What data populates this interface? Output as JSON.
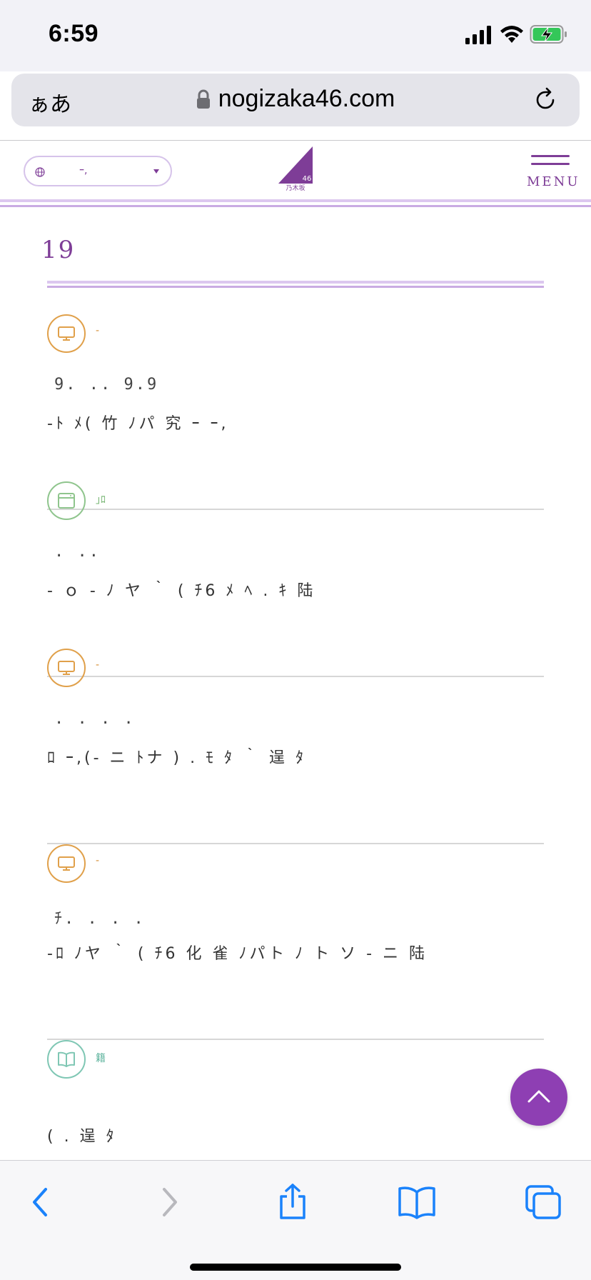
{
  "status_bar": {
    "time": "6:59"
  },
  "browser": {
    "text_size_label": "ぁあ",
    "url": "nogizaka46.com"
  },
  "header": {
    "language_value": "ｰ,",
    "logo_text": "46",
    "logo_subtext": "乃木坂",
    "menu_label": "MENU"
  },
  "page": {
    "heading": "19"
  },
  "news": [
    {
      "icon": "tv-icon",
      "category": "-",
      "date": "9. .. 9.9",
      "title": "‐ﾄ ﾒ( 竹 ﾉパ 究 ｰ ｰ,"
    },
    {
      "icon": "web-icon",
      "category": "｣ﾛ",
      "date": ". ..",
      "title": "‐ ｏ ‐ ﾉ ヤ ｀ ( ﾁ6  ﾒ ﾍ . ｷ 陆"
    },
    {
      "icon": "tv-icon",
      "category": "-",
      "date": ". . . .",
      "title": "ﾛ ｰ,(‐ ニ ﾄナ ) . ﾓ ﾀ ｀ 逞 ﾀ"
    },
    {
      "icon": "tv-icon",
      "category": "-",
      "date": "ﾁ. . . .",
      "title": "‐ﾛ ﾉヤ ｀ ( ﾁ6 化 雀 ﾉパト ﾉ ト ソ ‐ ニ 陆"
    },
    {
      "icon": "book-icon",
      "category": "籍",
      "date": "",
      "title": "( . 逞 ﾀ"
    }
  ],
  "colors": {
    "brand_purple": "#7e3d97",
    "tv_category": "#e0a04a",
    "web_category": "#8fc58d",
    "book_category": "#7fc7b4",
    "safari_blue": "#1a82fb"
  }
}
